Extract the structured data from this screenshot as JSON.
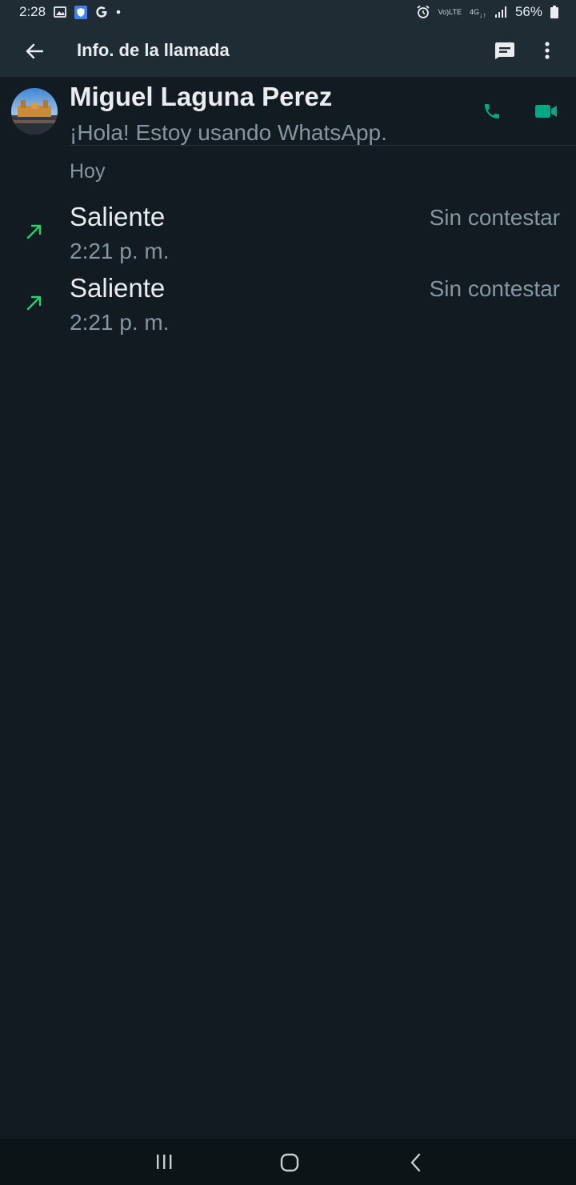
{
  "status_bar": {
    "time": "2:28",
    "battery": "56%",
    "volte_label_top": "Vo)",
    "volte_label_bottom": "LTE",
    "network_label": "4G",
    "left_icons": [
      "image-icon",
      "shield-icon",
      "google-icon",
      "dot-icon"
    ],
    "right_icons": [
      "alarm-icon",
      "volte-icon",
      "4g-icon",
      "signal-icon",
      "battery-icon"
    ]
  },
  "app_bar": {
    "title": "Info. de la llamada",
    "icons": [
      "back-arrow-icon",
      "message-icon",
      "more-vert-icon"
    ]
  },
  "contact": {
    "name": "Miguel Laguna Perez",
    "status": "¡Hola! Estoy usando WhatsApp.",
    "icons": [
      "phone-icon",
      "video-icon"
    ]
  },
  "section": {
    "label": "Hoy"
  },
  "calls": [
    {
      "type": "Saliente",
      "time": "2:21 p. m.",
      "result": "Sin contestar",
      "icon": "outgoing-arrow-icon"
    },
    {
      "type": "Saliente",
      "time": "2:21 p. m.",
      "result": "Sin contestar",
      "icon": "outgoing-arrow-icon"
    }
  ],
  "nav_bar": {
    "icons": [
      "recents-icon",
      "home-icon",
      "back-icon"
    ]
  },
  "colors": {
    "background": "#121b22",
    "app_bar": "#1f2c34",
    "accent_green": "#00a884",
    "outgoing_arrow": "#25d366",
    "primary_text": "#e9edef",
    "secondary_text": "#8696a0"
  }
}
